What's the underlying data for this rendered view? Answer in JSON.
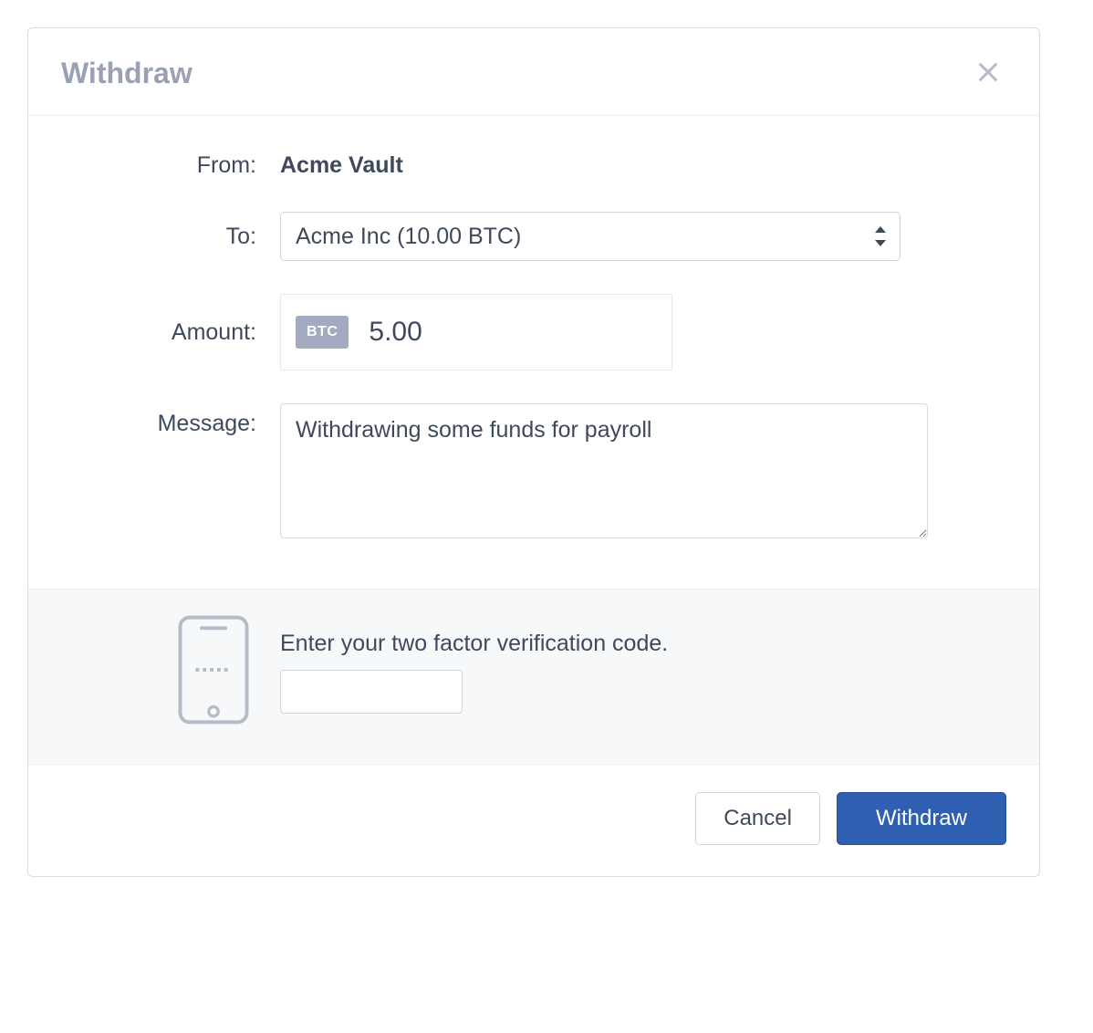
{
  "modal": {
    "title": "Withdraw"
  },
  "form": {
    "from_label": "From:",
    "from_value": "Acme Vault",
    "to_label": "To:",
    "to_selected": "Acme Inc (10.00 BTC)",
    "amount_label": "Amount:",
    "amount_currency": "BTC",
    "amount_value": "5.00",
    "message_label": "Message:",
    "message_value": "Withdrawing some funds for payroll"
  },
  "twofa": {
    "prompt": "Enter your two factor verification code.",
    "value": ""
  },
  "footer": {
    "cancel_label": "Cancel",
    "submit_label": "Withdraw"
  }
}
